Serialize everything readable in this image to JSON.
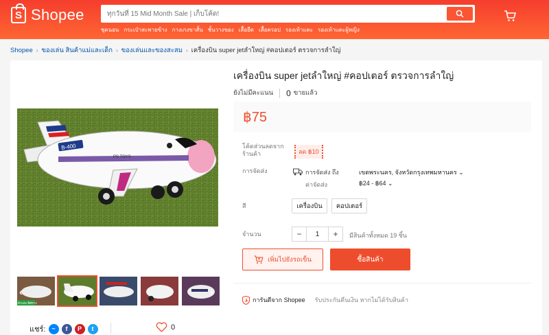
{
  "header": {
    "logo_mark": "S",
    "logo_text": "Shopee",
    "search_placeholder": "ทุกวันที่ 15 Mid Month Sale | เก็บโค้ด!",
    "hint_links": [
      "ชุดนอน",
      "กระเป๋าสะพายข้าง",
      "กางเกงขาสั้น",
      "ชั้นวางของ",
      "เสื้อยืด",
      "เสื้อครอป",
      "รองเท้าแตะ",
      "รองเท้าแตะผู้หญิง"
    ]
  },
  "breadcrumb": {
    "items": [
      "Shopee",
      "ของเล่น สินค้าแม่และเด็ก",
      "ของเล่นและของสะสม"
    ],
    "current": "เครื่องบิน super jetลำใหญ่ #คอปเตอร์ ตรวจการลำใญ่",
    "separator": "›"
  },
  "product": {
    "title": "เครื่องบิน super jetลำใหญ่ #คอปเตอร์ ตรวจการลำใญ่",
    "rating_text": "ยังไม่มีคะแนน",
    "sold_count": "0",
    "sold_label": "ขายแล้ว",
    "price": "฿75",
    "image_label": "B-400",
    "image_side_text": "PS TOYS",
    "thumb_badge": "ตัวเล่น ทิศทาง",
    "voucher_label": "โค้ดส่วนลดจากร้านค้า",
    "voucher_value": "ลด ฿10",
    "shipping_label": "การจัดส่ง",
    "ship_to_label": "การจัดส่ง ถึง",
    "ship_to_value": "เขตพระนคร, จังหวัดกรุงเทพมหานคร",
    "ship_cost_label": "ค่าจัดส่ง",
    "ship_cost_value": "฿24 - ฿64",
    "color_label": "สี",
    "options": [
      "เครื่องบิน",
      "คอปเตอร์"
    ],
    "qty_label": "จำนวน",
    "qty_minus": "−",
    "qty_value": "1",
    "qty_plus": "+",
    "stock_text": "มีสินค้าทั้งหมด 19 ชิ้น",
    "add_to_cart": "เพิ่มไปยังรถเข็น",
    "buy_now": "ซื้อสินค้า",
    "guarantee_title": "การันตีจาก Shopee",
    "guarantee_sub": "รับประกันคืนเงิน หากไม่ได้รับสินค้า",
    "share_label": "แชร์:",
    "favorites": "0"
  },
  "colors": {
    "brand": "#ee4d2d",
    "header_bg": "#f53d2d",
    "link": "#0055aa"
  }
}
